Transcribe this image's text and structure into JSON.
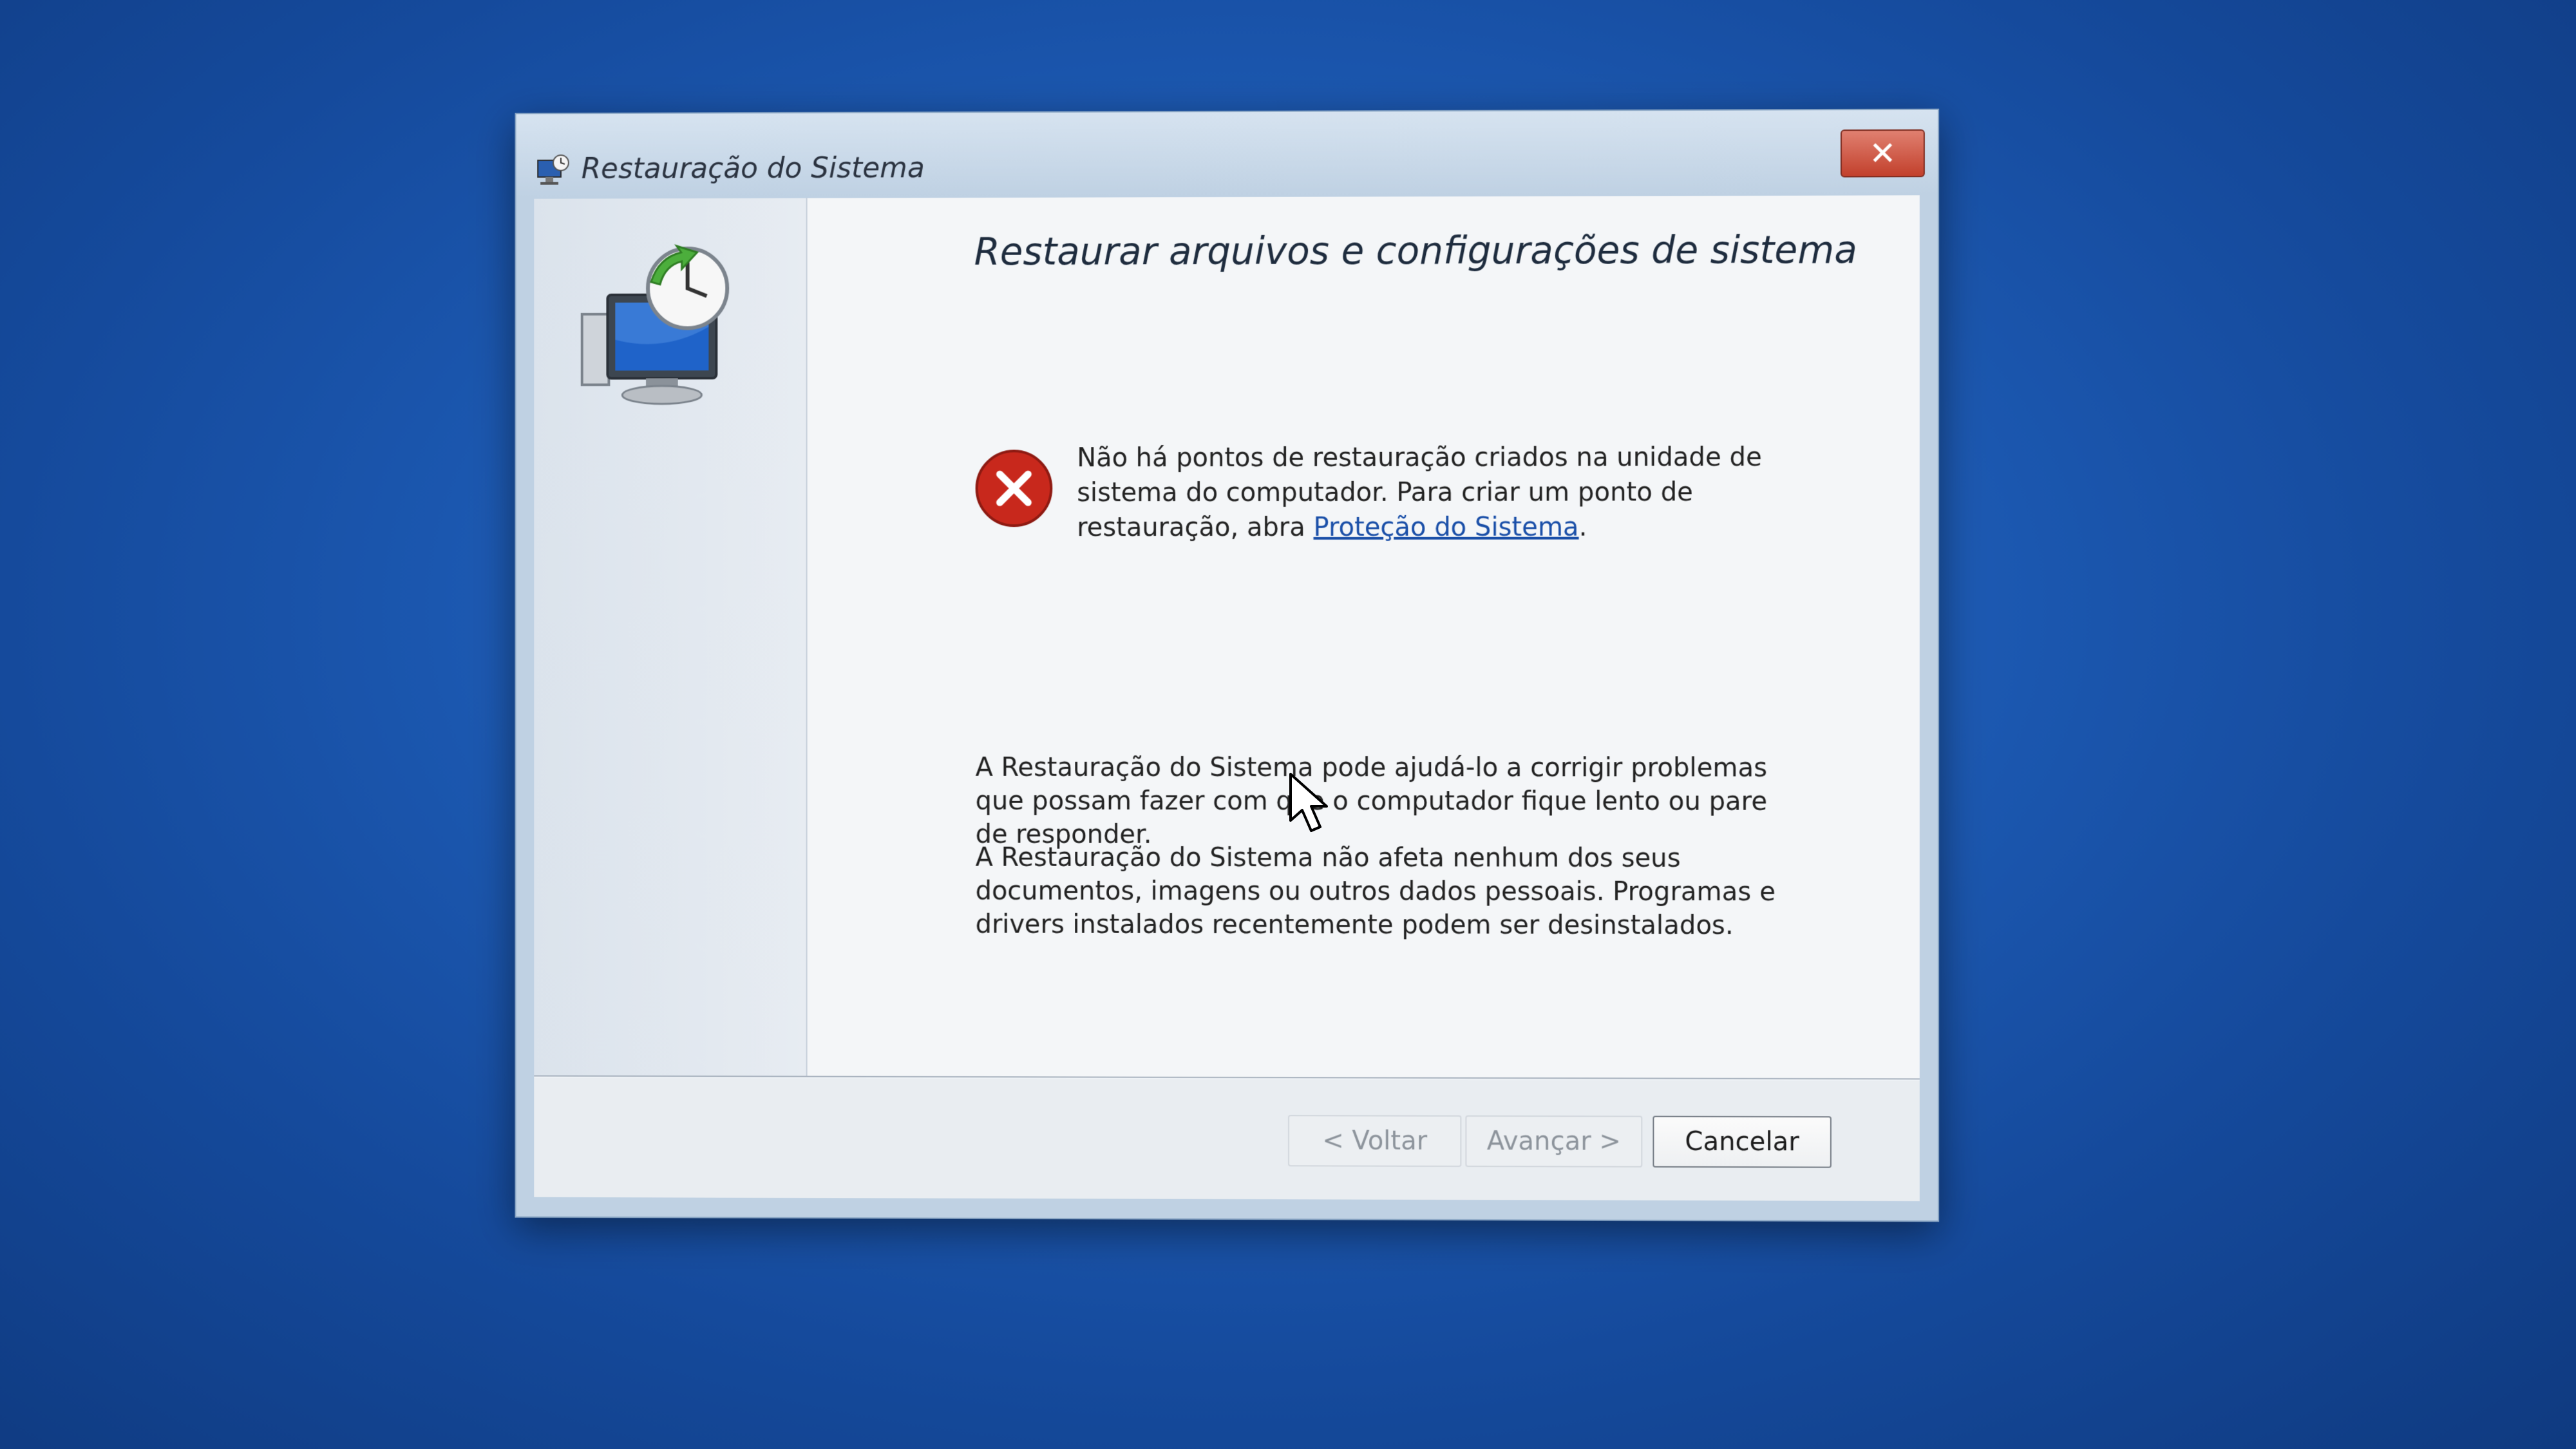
{
  "window": {
    "title": "Restauração do Sistema",
    "close_label": "✕"
  },
  "page": {
    "heading": "Restaurar arquivos e configurações de sistema",
    "error_message": "Não há pontos de restauração criados na unidade de sistema do computador. Para criar um ponto de restauração, abra ",
    "error_link": "Proteção do Sistema",
    "error_end": ".",
    "paragraph1": "A Restauração do Sistema pode ajudá-lo a corrigir problemas que possam fazer com que o computador fique lento ou pare de responder.",
    "paragraph2": "A Restauração do Sistema não afeta nenhum dos seus documentos, imagens ou outros dados pessoais. Programas e drivers instalados recentemente podem ser desinstalados."
  },
  "buttons": {
    "back": "< Voltar",
    "next": "Avançar >",
    "cancel": "Cancelar"
  },
  "icons": {
    "title": "system-restore-icon",
    "wizard": "system-restore-monitor-clock-icon",
    "error": "error-icon",
    "cursor": "mouse-pointer-icon"
  },
  "colors": {
    "desktop": "#1d5bb5",
    "close_button": "#c2402c",
    "error_icon": "#c8281c",
    "link": "#1a4fa8"
  }
}
